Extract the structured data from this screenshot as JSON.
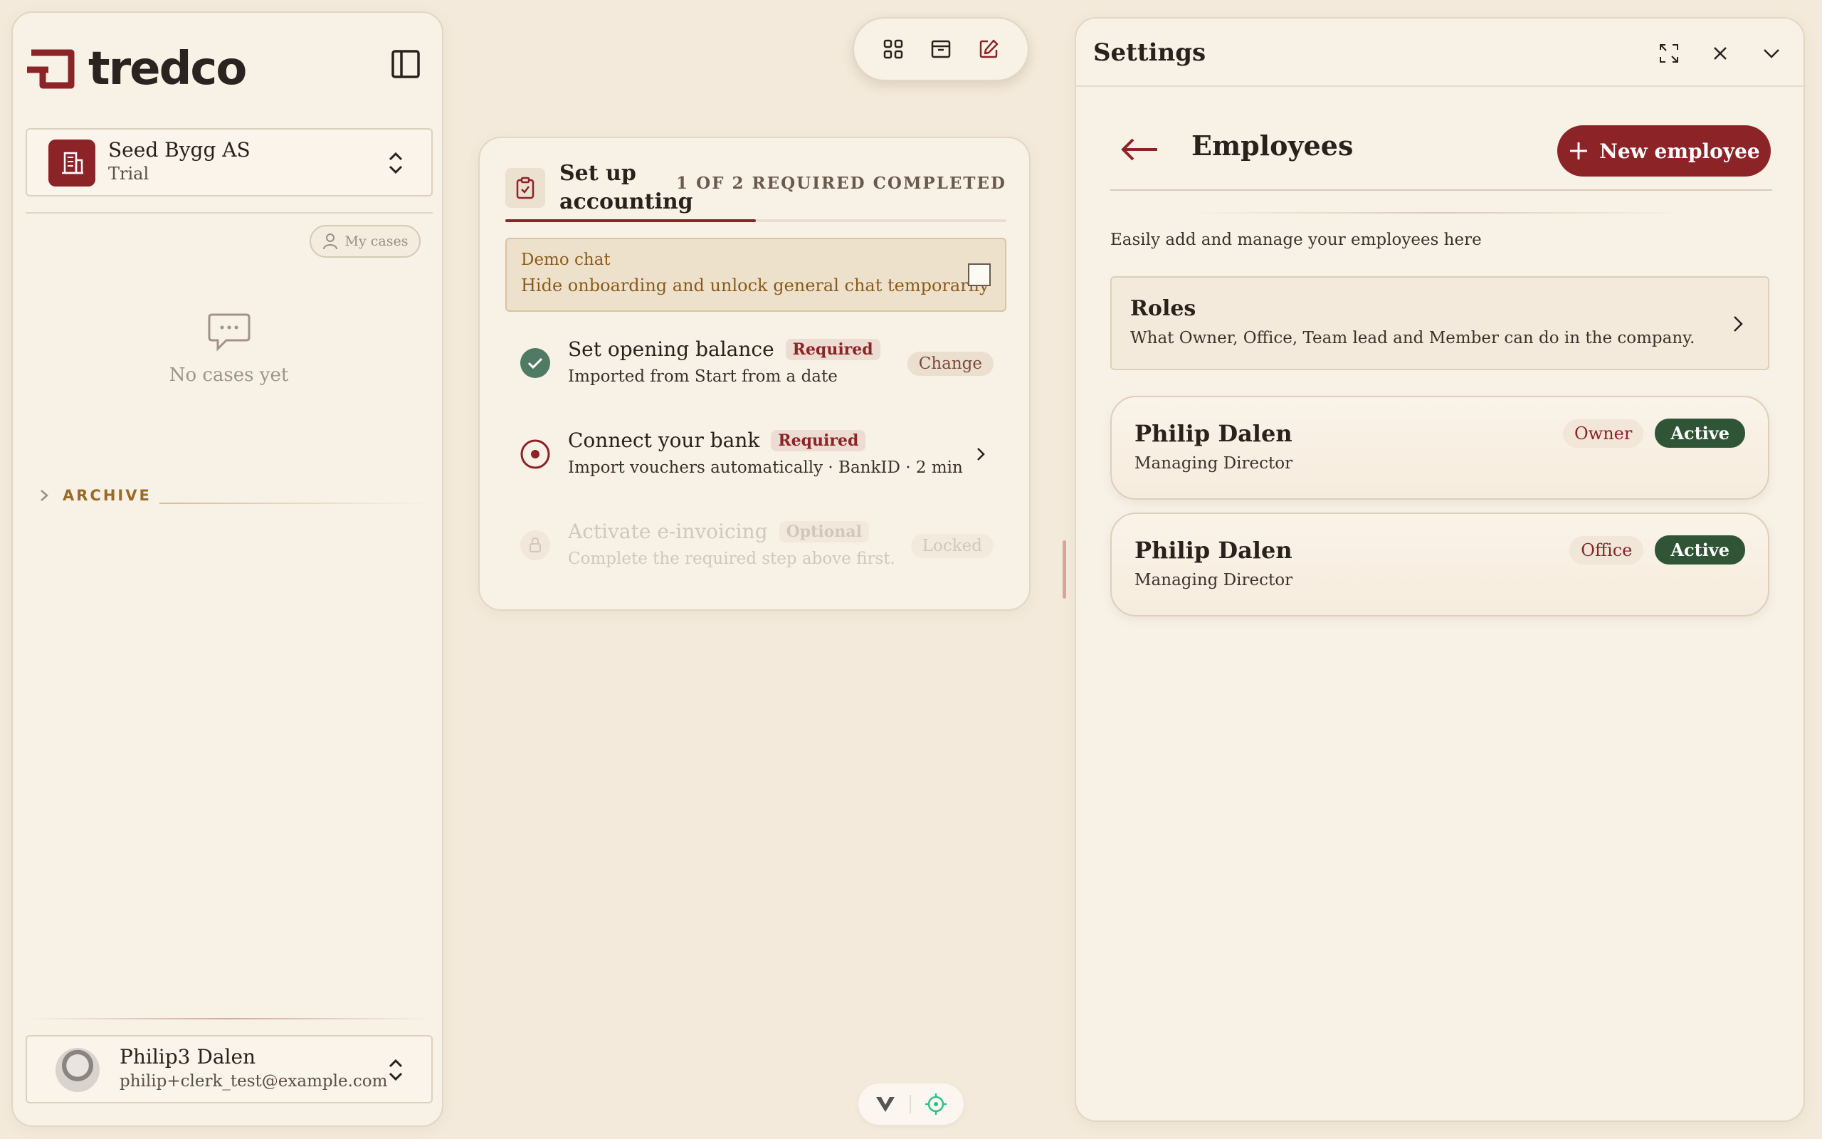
{
  "sidebar": {
    "logo_text": "tredco",
    "company": {
      "name": "Seed Bygg AS",
      "plan": "Trial"
    },
    "my_cases_label": "My cases",
    "empty_cases_text": "No cases yet",
    "archive_label": "ARCHIVE",
    "user": {
      "name": "Philip3 Dalen",
      "email": "philip+clerk_test@example.com"
    }
  },
  "toolbar": {
    "icons": [
      "grid-icon",
      "inbox-icon",
      "edit-icon"
    ]
  },
  "onboarding": {
    "title": "Set up accounting",
    "progress_text": "1 OF 2 REQUIRED COMPLETED",
    "progress_fraction": 0.5,
    "demo": {
      "title": "Demo chat",
      "subtitle": "Hide onboarding and unlock general chat temporarily",
      "checked": false
    },
    "steps": [
      {
        "title": "Set opening balance",
        "tag": "Required",
        "subtitle": "Imported from Start from a date",
        "action": "Change",
        "state": "done"
      },
      {
        "title": "Connect your bank",
        "tag": "Required",
        "subtitle": "Import vouchers automatically · BankID · 2 min",
        "action": "",
        "state": "current"
      },
      {
        "title": "Activate e-invoicing",
        "tag": "Optional",
        "subtitle": "Complete the required step above first.",
        "action": "Locked",
        "state": "locked"
      }
    ]
  },
  "settings": {
    "title": "Settings",
    "employees_title": "Employees",
    "new_employee_label": "New employee",
    "description": "Easily add and manage your employees here",
    "roles": {
      "title": "Roles",
      "subtitle": "What Owner, Office, Team lead and Member can do in the company."
    },
    "employees": [
      {
        "name": "Philip Dalen",
        "title": "Managing Director",
        "role": "Owner",
        "status": "Active"
      },
      {
        "name": "Philip Dalen",
        "title": "Managing Director",
        "role": "Office",
        "status": "Active"
      }
    ]
  },
  "colors": {
    "accent": "#8b2327",
    "background": "#f3eadb",
    "panel": "#f8f1e6",
    "status_active": "#2f5436",
    "archive_label": "#9b6a25"
  }
}
